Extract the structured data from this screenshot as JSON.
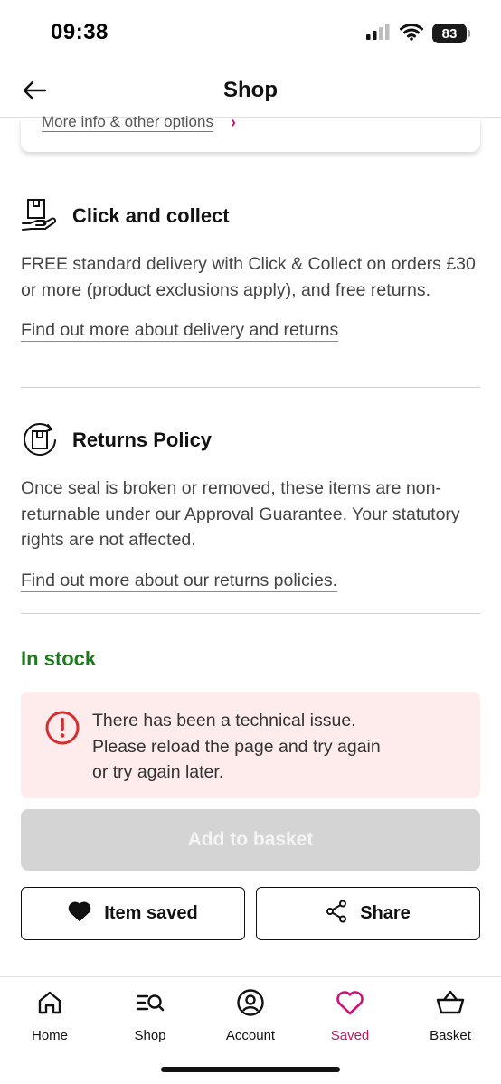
{
  "status_bar": {
    "time": "09:38",
    "battery": "83",
    "icons": [
      "cellular-signal-icon",
      "wifi-icon",
      "battery-icon"
    ]
  },
  "header": {
    "title": "Shop",
    "back_icon": "arrow-left-icon"
  },
  "card_remnant": {
    "more_info_label": "More info & other options",
    "chevron": "›"
  },
  "click_collect": {
    "icon": "box-in-hand-icon",
    "title": "Click and collect",
    "body": "FREE standard delivery with Click & Collect on orders £30 or more (product exclusions apply), and free returns.",
    "link": "Find out more about delivery and returns"
  },
  "returns": {
    "icon": "returns-box-icon",
    "title": "Returns Policy",
    "body": "Once seal is broken or removed, these items are non-returnable under our Approval Guarantee. Your statutory rights are not affected.",
    "link": "Find out more about our returns policies."
  },
  "stock": {
    "label": "In stock"
  },
  "error": {
    "icon": "exclamation-circle-icon",
    "lines": [
      "There has been a technical issue.",
      "Please reload the page and try again",
      "or try again later."
    ]
  },
  "actions": {
    "add_to_basket": "Add to basket",
    "item_saved": "Item saved",
    "share": "Share"
  },
  "bottom_nav": {
    "items": [
      {
        "label": "Home",
        "icon": "home-icon",
        "active": false
      },
      {
        "label": "Shop",
        "icon": "shop-search-icon",
        "active": false
      },
      {
        "label": "Account",
        "icon": "account-icon",
        "active": false
      },
      {
        "label": "Saved",
        "icon": "heart-icon",
        "active": true
      },
      {
        "label": "Basket",
        "icon": "basket-icon",
        "active": false
      }
    ]
  },
  "colors": {
    "brand_pink": "#d0117a",
    "stock_green": "#1b7a1b",
    "error_red": "#d32f2f",
    "error_bg": "#fdeceb",
    "disabled_button": "#d4d4d4"
  }
}
